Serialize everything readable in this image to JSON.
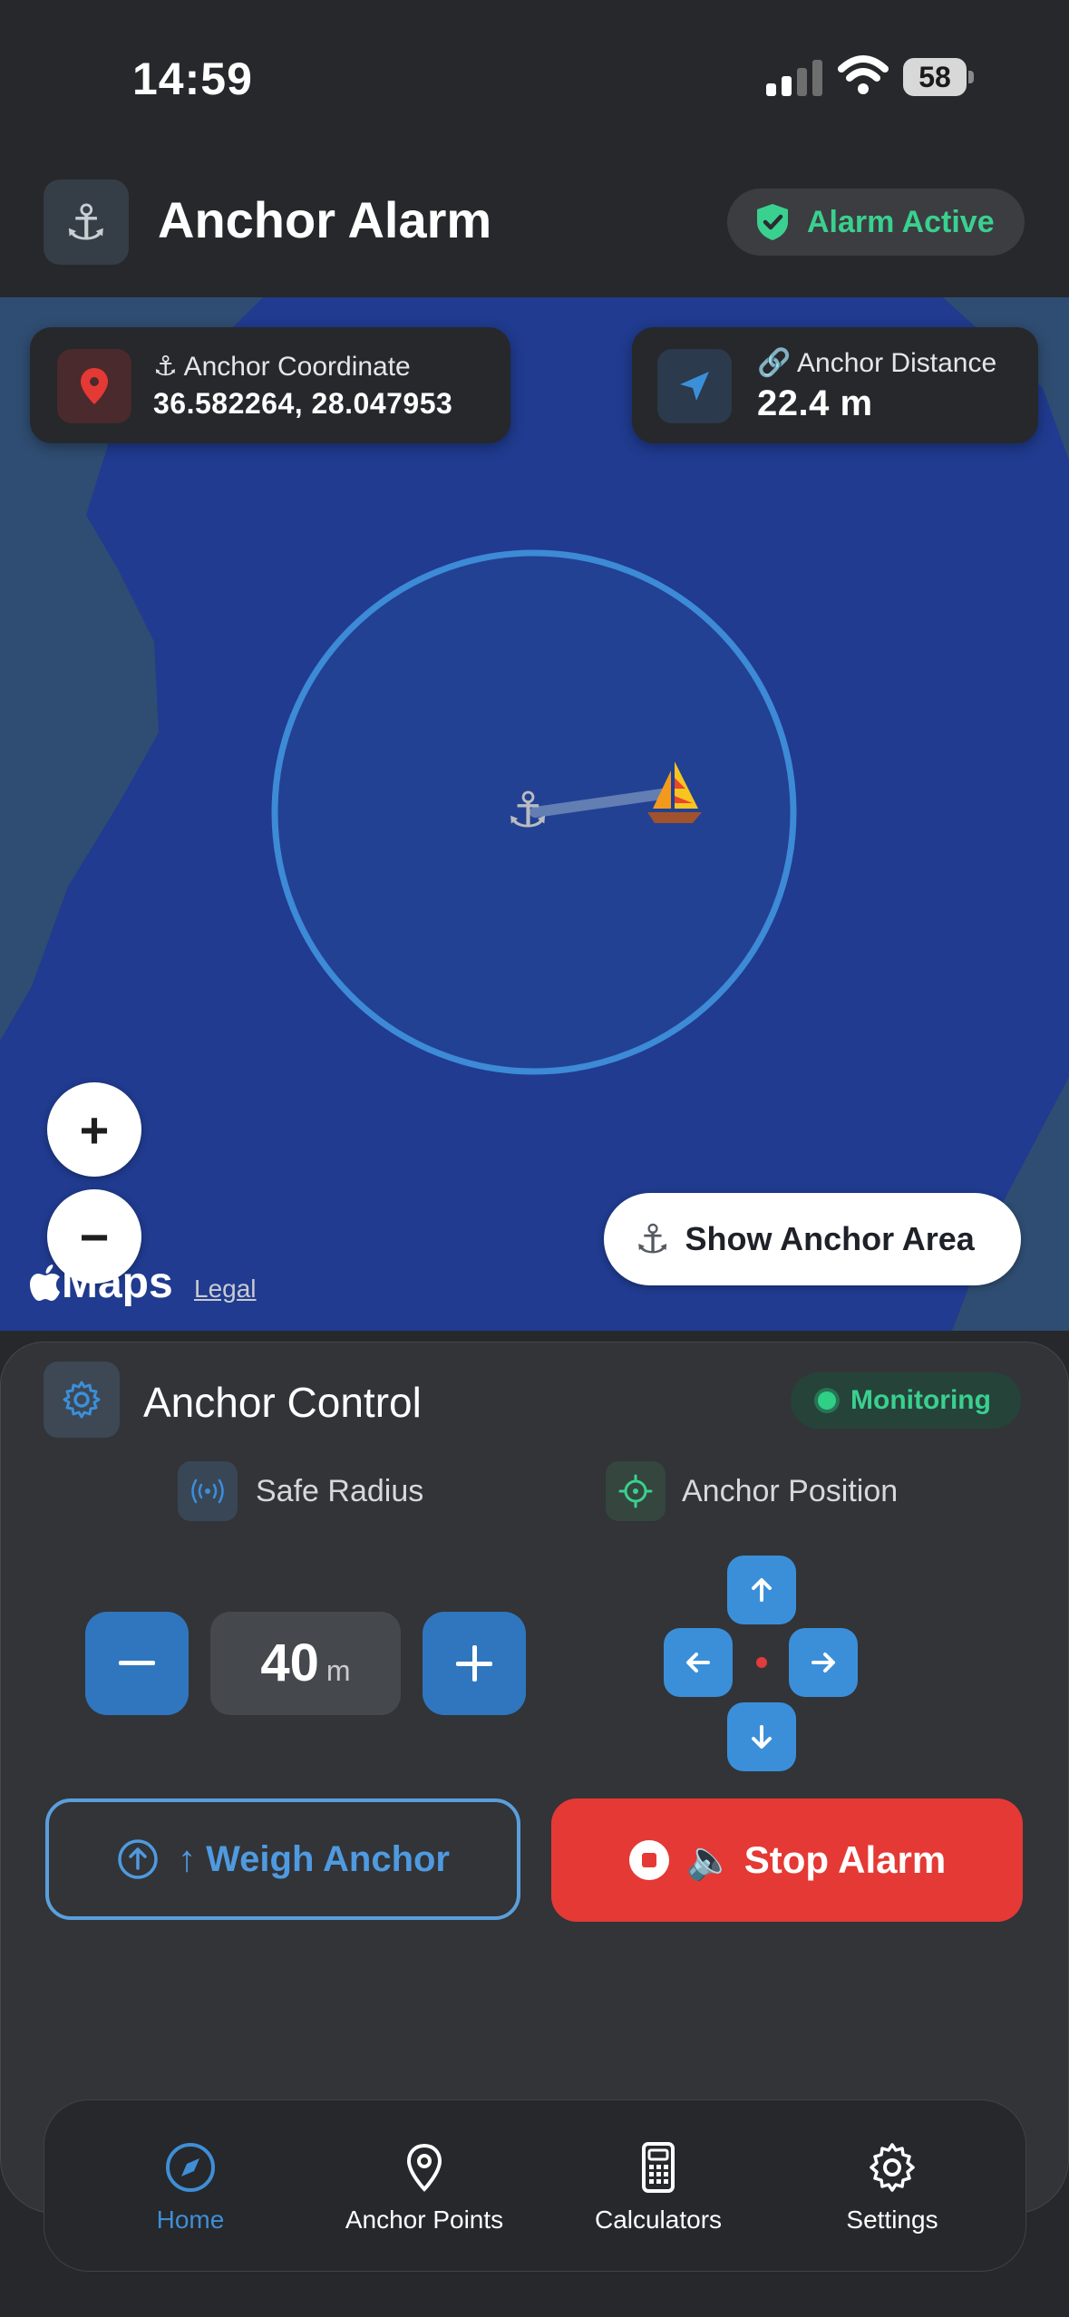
{
  "status_bar": {
    "time": "14:59",
    "battery": "58"
  },
  "header": {
    "title": "Anchor Alarm",
    "alarm_status": "Alarm Active",
    "icon": "anchor-icon"
  },
  "map": {
    "coordinate_label": "Anchor Coordinate",
    "coordinate_value": "36.582264, 28.047953",
    "distance_label": "Anchor Distance",
    "distance_value": "22.4 m",
    "zoom_in": "+",
    "zoom_out": "−",
    "maps_brand": "Maps",
    "legal": "Legal",
    "show_area_label": "Show Anchor Area",
    "colors": {
      "water": "#203b8f",
      "land": "#2f4d72",
      "circle": "#3d8ad6"
    }
  },
  "control": {
    "title": "Anchor Control",
    "status": "Monitoring",
    "safe_radius_label": "Safe Radius",
    "anchor_position_label": "Anchor Position",
    "radius_value": "40",
    "radius_unit": "m",
    "weigh_label": "↑ Weigh Anchor",
    "stop_label": "🔈 Stop Alarm"
  },
  "tabs": [
    {
      "label": "Home",
      "icon": "compass-icon",
      "active": true
    },
    {
      "label": "Anchor Points",
      "icon": "map-pin-icon",
      "active": false
    },
    {
      "label": "Calculators",
      "icon": "calculator-icon",
      "active": false
    },
    {
      "label": "Settings",
      "icon": "gear-icon",
      "active": false
    }
  ],
  "accent_colors": {
    "primary": "#2f76bf",
    "success": "#3ad08f",
    "danger": "#e53935"
  }
}
